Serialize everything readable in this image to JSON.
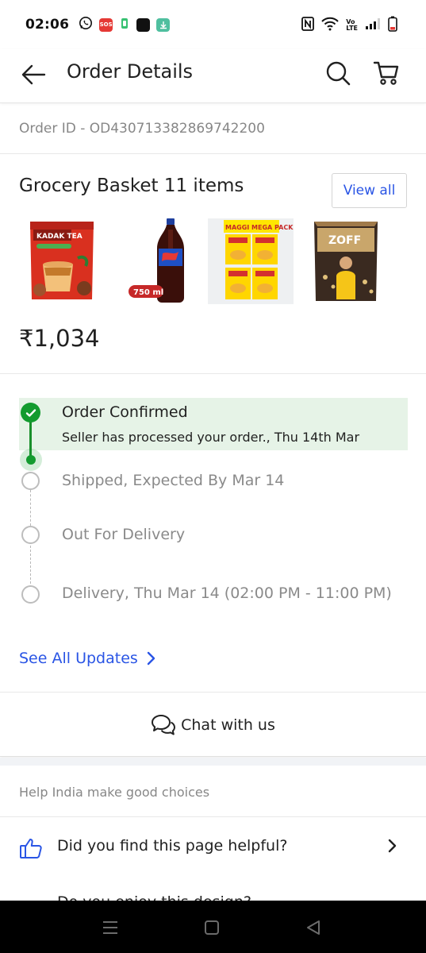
{
  "status_bar": {
    "time": "02:06",
    "sos_label": "SOS",
    "network_label_top": "Vo",
    "network_label_bottom": "LTE"
  },
  "header": {
    "title": "Order Details",
    "back_icon": "arrow-left-icon",
    "search_icon": "search-icon",
    "cart_icon": "cart-icon"
  },
  "order": {
    "id_text": "Order ID - OD430713382869742200"
  },
  "basket": {
    "title": "Grocery Basket 11 items",
    "view_all_label": "View all",
    "price": "₹1,034",
    "items": [
      {
        "name": "Kadak Tea pack",
        "label": "KADAK TEA"
      },
      {
        "name": "Cola bottle",
        "badge": "750 ml"
      },
      {
        "name": "Maggi Mega Pack",
        "label": "MAGGI MEGA PACK"
      },
      {
        "name": "Zoff spice pack",
        "label": "ZOFF"
      }
    ]
  },
  "tracker": {
    "steps": [
      {
        "title": "Order Confirmed",
        "subtitle": "Seller has processed your order., Thu 14th Mar",
        "status": "done"
      },
      {
        "title": "Shipped, Expected By Mar 14",
        "status": "pending"
      },
      {
        "title": "Out For Delivery",
        "status": "pending"
      },
      {
        "title": "Delivery, Thu Mar 14 (02:00 PM - 11:00 PM)",
        "status": "pending"
      }
    ],
    "see_all_label": "See All Updates"
  },
  "chat": {
    "label": "Chat with us"
  },
  "help": {
    "heading": "Help India make good choices",
    "question": "Did you find this page helpful?",
    "next_question_cut": "Do you enjoy this design?"
  },
  "colors": {
    "accent_blue": "#2a55e5",
    "success_green": "#139b2f",
    "confirmed_bg": "#e6f3e7",
    "muted_text": "#878787"
  }
}
